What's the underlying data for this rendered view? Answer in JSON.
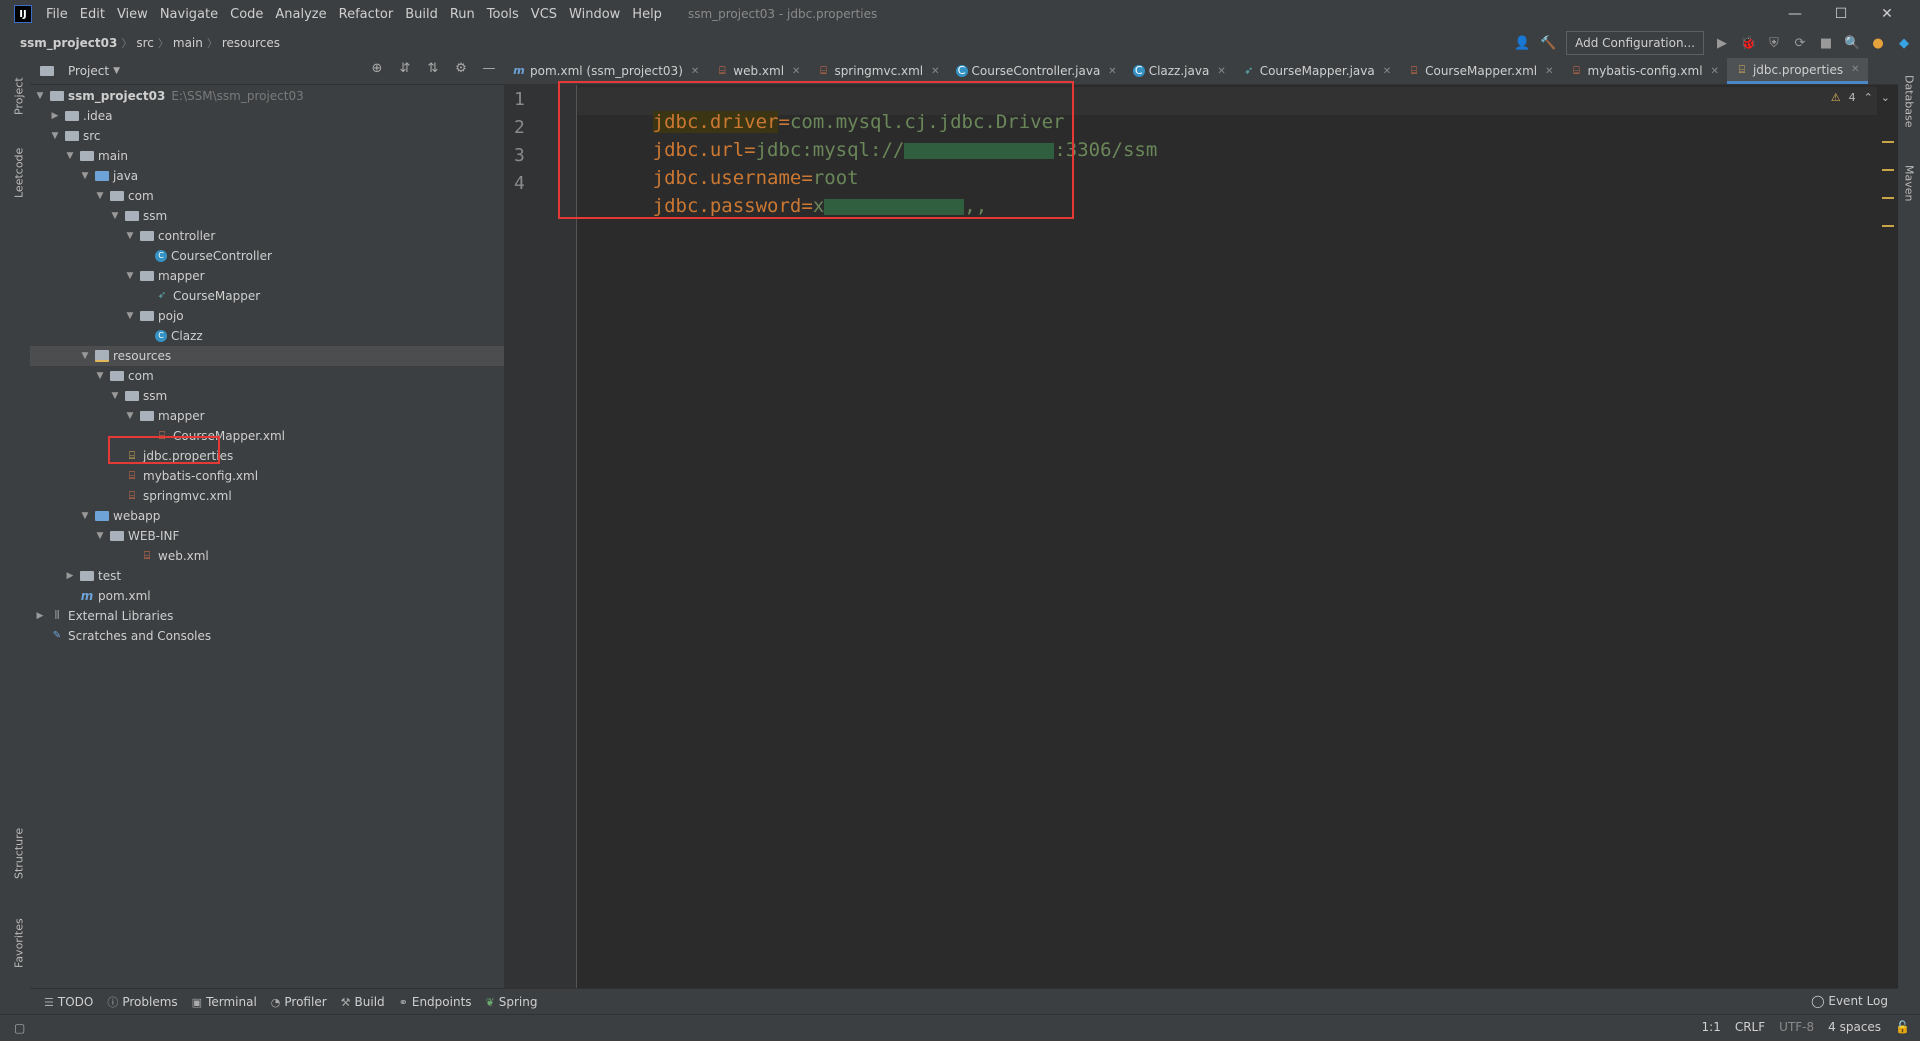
{
  "app": {
    "logo_text": "IJ",
    "window_title": "ssm_project03 - jdbc.properties",
    "menu": [
      "File",
      "Edit",
      "View",
      "Navigate",
      "Code",
      "Analyze",
      "Refactor",
      "Build",
      "Run",
      "Tools",
      "VCS",
      "Window",
      "Help"
    ],
    "window_controls": {
      "minimize": "—",
      "maximize": "☐",
      "close": "✕"
    }
  },
  "breadcrumb": {
    "project": "ssm_project03",
    "items": [
      "src",
      "main",
      "resources"
    ]
  },
  "toolbar": {
    "add_configuration": "Add Configuration..."
  },
  "left_stripe": {
    "project": "Project",
    "leetcode": "Leetcode",
    "structure": "Structure",
    "favorites": "Favorites"
  },
  "right_stripe": {
    "database": "Database",
    "maven": "Maven"
  },
  "project_panel": {
    "title": "Project",
    "tree": [
      {
        "label": "ssm_project03",
        "path": "E:\\SSM\\ssm_project03",
        "depth": 0,
        "arrow": "v",
        "icon": "module"
      },
      {
        "label": ".idea",
        "depth": 1,
        "arrow": ">",
        "icon": "folder"
      },
      {
        "label": "src",
        "depth": 1,
        "arrow": "v",
        "icon": "folder"
      },
      {
        "label": "main",
        "depth": 2,
        "arrow": "v",
        "icon": "folder"
      },
      {
        "label": "java",
        "depth": 3,
        "arrow": "v",
        "icon": "folder-blue"
      },
      {
        "label": "com",
        "depth": 4,
        "arrow": "v",
        "icon": "folder"
      },
      {
        "label": "ssm",
        "depth": 5,
        "arrow": "v",
        "icon": "folder"
      },
      {
        "label": "controller",
        "depth": 6,
        "arrow": "v",
        "icon": "folder"
      },
      {
        "label": "CourseController",
        "depth": 7,
        "arrow": "",
        "icon": "class"
      },
      {
        "label": "mapper",
        "depth": 6,
        "arrow": "v",
        "icon": "folder"
      },
      {
        "label": "CourseMapper",
        "depth": 7,
        "arrow": "",
        "icon": "mapper"
      },
      {
        "label": "pojo",
        "depth": 6,
        "arrow": "v",
        "icon": "folder"
      },
      {
        "label": "Clazz",
        "depth": 7,
        "arrow": "",
        "icon": "class"
      },
      {
        "label": "resources",
        "depth": 3,
        "arrow": "v",
        "icon": "folder-res",
        "selected": true
      },
      {
        "label": "com",
        "depth": 4,
        "arrow": "v",
        "icon": "folder"
      },
      {
        "label": "ssm",
        "depth": 5,
        "arrow": "v",
        "icon": "folder"
      },
      {
        "label": "mapper",
        "depth": 6,
        "arrow": "v",
        "icon": "folder"
      },
      {
        "label": "CourseMapper.xml",
        "depth": 7,
        "arrow": "",
        "icon": "xml"
      },
      {
        "label": "jdbc.properties",
        "depth": 5,
        "arrow": "",
        "icon": "prop"
      },
      {
        "label": "mybatis-config.xml",
        "depth": 5,
        "arrow": "",
        "icon": "xml"
      },
      {
        "label": "springmvc.xml",
        "depth": 5,
        "arrow": "",
        "icon": "xml"
      },
      {
        "label": "webapp",
        "depth": 3,
        "arrow": "v",
        "icon": "folder-blue"
      },
      {
        "label": "WEB-INF",
        "depth": 4,
        "arrow": "v",
        "icon": "folder"
      },
      {
        "label": "web.xml",
        "depth": 6,
        "arrow": "",
        "icon": "xml"
      },
      {
        "label": "test",
        "depth": 2,
        "arrow": ">",
        "icon": "folder"
      },
      {
        "label": "pom.xml",
        "depth": 2,
        "arrow": "",
        "icon": "mvn"
      },
      {
        "label": "External Libraries",
        "depth": 0,
        "arrow": ">",
        "icon": "lib"
      },
      {
        "label": "Scratches and Consoles",
        "depth": 0,
        "arrow": "",
        "icon": "scratch"
      }
    ]
  },
  "editor_tabs": [
    {
      "label": "pom.xml (ssm_project03)",
      "icon": "mvn"
    },
    {
      "label": "web.xml",
      "icon": "xml"
    },
    {
      "label": "springmvc.xml",
      "icon": "xml"
    },
    {
      "label": "CourseController.java",
      "icon": "class"
    },
    {
      "label": "Clazz.java",
      "icon": "class"
    },
    {
      "label": "CourseMapper.java",
      "icon": "mapper"
    },
    {
      "label": "CourseMapper.xml",
      "icon": "xml"
    },
    {
      "label": "mybatis-config.xml",
      "icon": "xml"
    },
    {
      "label": "jdbc.properties",
      "icon": "prop",
      "active": true
    }
  ],
  "editor": {
    "inspection_count": "4",
    "lines": [
      {
        "num": "1",
        "key": "jdbc.driver",
        "eq": "=",
        "value": "com.mysql.cj.jdbc.Driver"
      },
      {
        "num": "2",
        "key": "jdbc.url",
        "eq": "=",
        "value_a": "jdbc:mysql://",
        "value_b": ":3306/ssm"
      },
      {
        "num": "3",
        "key": "jdbc.username",
        "eq": "=",
        "value": "root"
      },
      {
        "num": "4",
        "key": "jdbc.password",
        "eq": "=",
        "value_a": "x",
        "value_b": ",,"
      }
    ]
  },
  "bottom_tools": [
    "TODO",
    "Problems",
    "Terminal",
    "Profiler",
    "Build",
    "Endpoints",
    "Spring"
  ],
  "event_log": "Event Log",
  "status": {
    "position": "1:1",
    "line_sep": "CRLF",
    "encoding": "UTF-8",
    "indent": "4 spaces"
  },
  "colors": {
    "accent": "#4a88c7",
    "highlight_box": "#e53935",
    "key": "#cc7832",
    "value": "#6a8759"
  }
}
